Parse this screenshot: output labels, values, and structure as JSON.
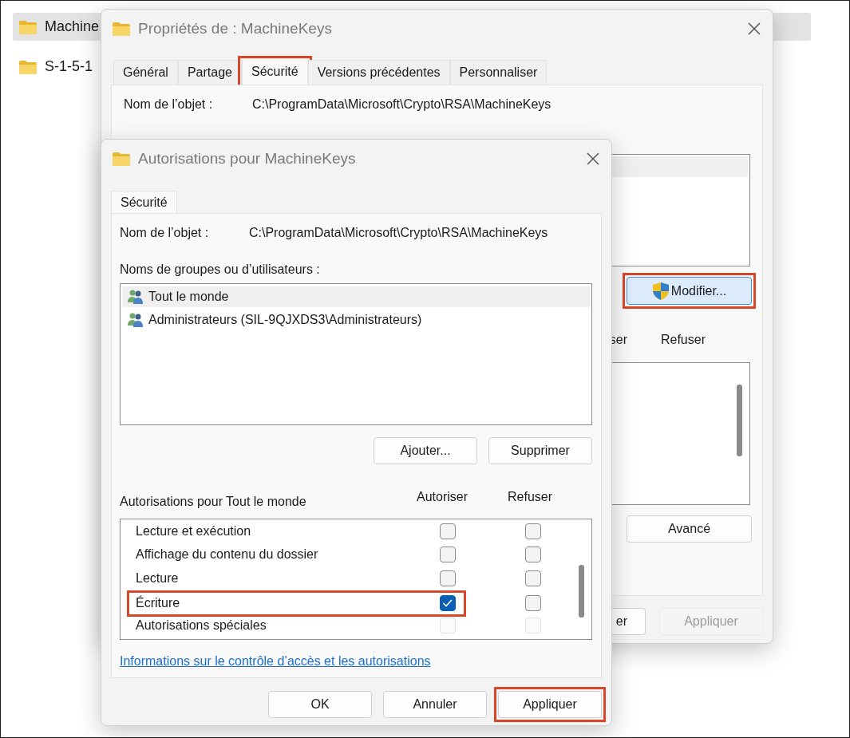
{
  "explorer": {
    "items": [
      {
        "name": "Machine",
        "selected": true
      },
      {
        "name": "S-1-5-1",
        "selected": false
      }
    ]
  },
  "properties_window": {
    "title": "Propriétés de : MachineKeys",
    "tabs": [
      {
        "label": "Général",
        "selected": false,
        "highlighted": false
      },
      {
        "label": "Partage",
        "selected": false,
        "highlighted": false
      },
      {
        "label": "Sécurité",
        "selected": true,
        "highlighted": true
      },
      {
        "label": "Versions précédentes",
        "selected": false,
        "highlighted": false
      },
      {
        "label": "Personnaliser",
        "selected": false,
        "highlighted": false
      }
    ],
    "object_name_label": "Nom de l’objet :",
    "object_name": "C:\\ProgramData\\Microsoft\\Crypto\\RSA\\MachineKeys",
    "edit_button": {
      "label": "Modifier...",
      "highlighted": true
    },
    "allow_header": "ser",
    "deny_header": "Refuser",
    "advanced_button": "Avancé",
    "buttons": [
      {
        "label": "er",
        "disabled": false
      },
      {
        "label": "Appliquer",
        "disabled": true
      }
    ]
  },
  "permissions_window": {
    "title": "Autorisations pour MachineKeys",
    "tabs": [
      {
        "label": "Sécurité",
        "selected": true
      }
    ],
    "object_name_label": "Nom de l’objet :",
    "object_name": "C:\\ProgramData\\Microsoft\\Crypto\\RSA\\MachineKeys",
    "groups_label": "Noms de groupes ou d’utilisateurs :",
    "principals": [
      {
        "name": "Tout le monde",
        "selected": true
      },
      {
        "name": "Administrateurs (SIL-9QJXDS3\\Administrateurs)",
        "selected": false
      }
    ],
    "add_button": "Ajouter...",
    "remove_button": "Supprimer",
    "permissions_label": "Autorisations pour Tout le monde",
    "allow_header": "Autoriser",
    "deny_header": "Refuser",
    "permissions": [
      {
        "name": "Lecture et exécution",
        "highlighted": false,
        "allow": {
          "checked": false,
          "disabled": false
        },
        "deny": {
          "checked": false,
          "disabled": false
        }
      },
      {
        "name": "Affichage du contenu du dossier",
        "highlighted": false,
        "allow": {
          "checked": false,
          "disabled": false
        },
        "deny": {
          "checked": false,
          "disabled": false
        }
      },
      {
        "name": "Lecture",
        "highlighted": false,
        "allow": {
          "checked": false,
          "disabled": false
        },
        "deny": {
          "checked": false,
          "disabled": false
        }
      },
      {
        "name": "Écriture",
        "highlighted": true,
        "allow": {
          "checked": true,
          "disabled": false
        },
        "deny": {
          "checked": false,
          "disabled": false
        }
      },
      {
        "name": "Autorisations spéciales",
        "highlighted": false,
        "allow": {
          "checked": false,
          "disabled": true
        },
        "deny": {
          "checked": false,
          "disabled": true
        }
      }
    ],
    "help_link": "Informations sur le contrôle d’accès et les autorisations",
    "buttons": [
      {
        "label": "OK",
        "disabled": false,
        "highlighted": false
      },
      {
        "label": "Annuler",
        "disabled": false,
        "highlighted": false
      },
      {
        "label": "Appliquer",
        "disabled": false,
        "highlighted": true
      }
    ]
  }
}
